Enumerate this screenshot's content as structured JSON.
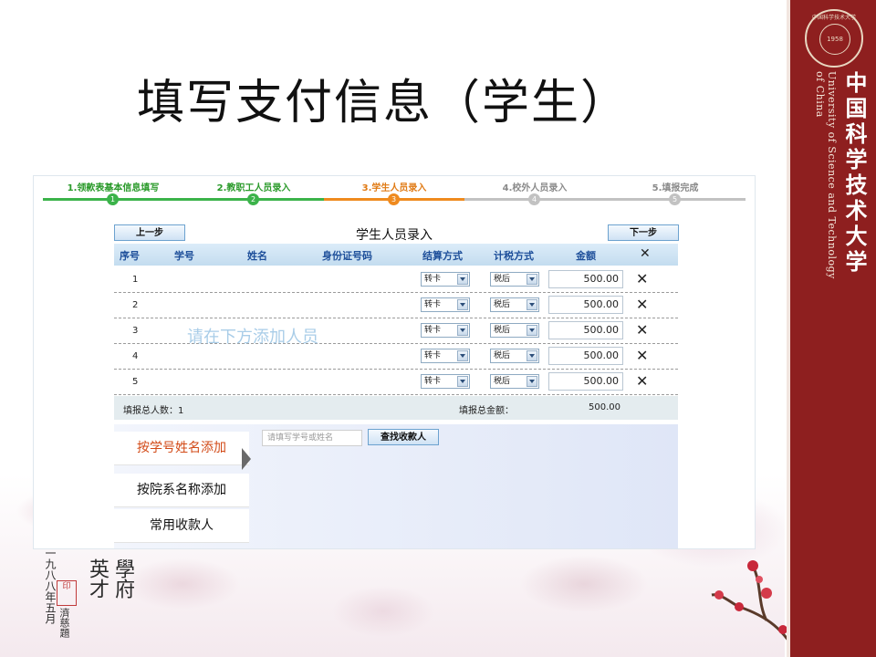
{
  "slide": {
    "title": "填写支付信息（学生）"
  },
  "banner": {
    "university_cn": "中国科学技术大学",
    "university_en": "University of Science and Technology of China",
    "logo_year": "1958",
    "logo_ring": "中国科学技术大学",
    "accent": "#8e1f1f"
  },
  "calligraphy": {
    "col1": "英才",
    "col2": "學府",
    "note": "一九八八年五月",
    "sig": "濟慈題",
    "seal": "印"
  },
  "steps": [
    {
      "label": "1.领款表基本信息填写",
      "num": "1",
      "state": "done"
    },
    {
      "label": "2.教职工人员录入",
      "num": "2",
      "state": "done"
    },
    {
      "label": "3.学生人员录入",
      "num": "3",
      "state": "active"
    },
    {
      "label": "4.校外人员录入",
      "num": "4",
      "state": "pending"
    },
    {
      "label": "5.填报完成",
      "num": "5",
      "state": "pending"
    }
  ],
  "form": {
    "title": "学生人员录入",
    "prev_label": "上一步",
    "next_label": "下一步",
    "hint": "请在下方添加人员",
    "columns": [
      "序号",
      "学号",
      "姓名",
      "身份证号码",
      "结算方式",
      "计税方式",
      "金额",
      "✕"
    ],
    "rows": [
      {
        "no": "1",
        "settle": "转卡",
        "tax": "税后",
        "amount": "500.00"
      },
      {
        "no": "2",
        "settle": "转卡",
        "tax": "税后",
        "amount": "500.00"
      },
      {
        "no": "3",
        "settle": "转卡",
        "tax": "税后",
        "amount": "500.00"
      },
      {
        "no": "4",
        "settle": "转卡",
        "tax": "税后",
        "amount": "500.00"
      },
      {
        "no": "5",
        "settle": "转卡",
        "tax": "税后",
        "amount": "500.00"
      }
    ],
    "summary": {
      "count_label": "填报总人数：1",
      "total_label": "填报总金额：",
      "total_value": "500.00"
    }
  },
  "lower": {
    "tabs": [
      "按学号姓名添加",
      "按院系名称添加",
      "常用收款人"
    ],
    "active_tab": 0,
    "search_placeholder": "请填写学号或姓名",
    "search_button": "查找收款人"
  }
}
